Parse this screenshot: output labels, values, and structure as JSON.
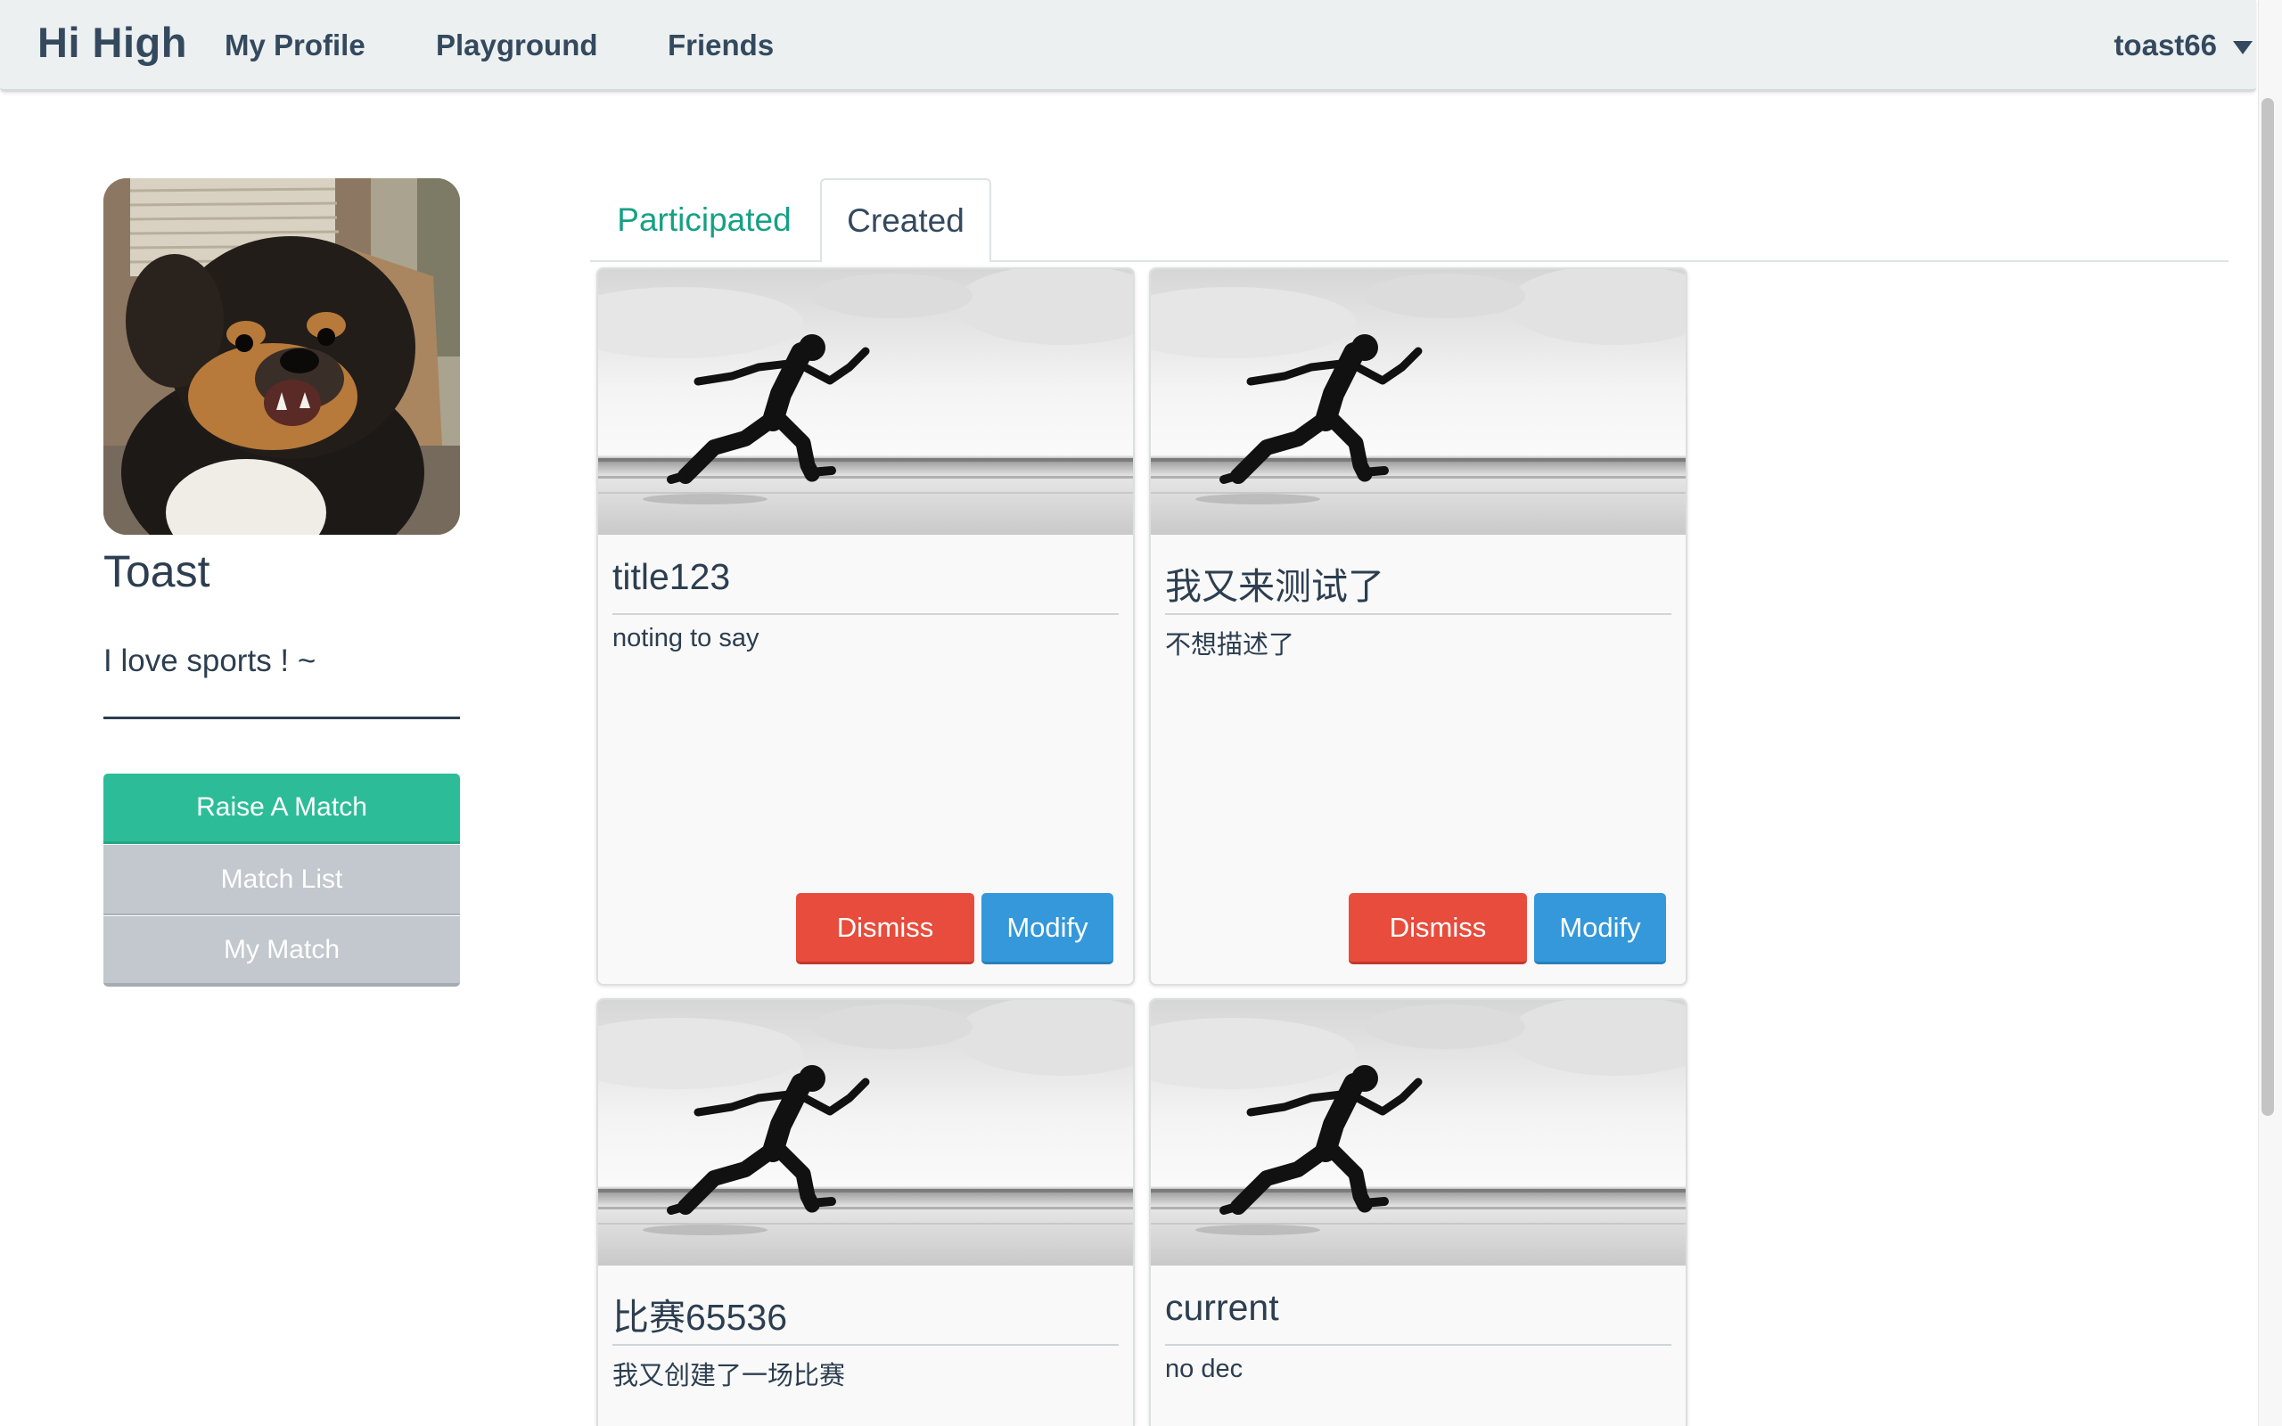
{
  "navbar": {
    "brand": "Hi High",
    "items": [
      {
        "label": "My Profile"
      },
      {
        "label": "Playground"
      },
      {
        "label": "Friends"
      }
    ],
    "username": "toast66"
  },
  "profile": {
    "name": "Toast",
    "bio": "I love sports ! ~",
    "actions": {
      "raise": "Raise A Match",
      "list": "Match List",
      "mine": "My Match"
    }
  },
  "tabs": {
    "participated": "Participated",
    "created": "Created"
  },
  "cards": [
    {
      "title": "title123",
      "description": "noting to say",
      "dismiss": "Dismiss",
      "modify": "Modify"
    },
    {
      "title": "我又来测试了",
      "description": "不想描述了",
      "dismiss": "Dismiss",
      "modify": "Modify"
    },
    {
      "title": "比赛65536",
      "description": "我又创建了一场比赛"
    },
    {
      "title": "current",
      "description": "no dec"
    }
  ],
  "colors": {
    "navbar_bg": "#ecf0f1",
    "primary": "#2cbd98",
    "tab_active_text": "#16a085",
    "danger": "#e74c3c",
    "info": "#3498db",
    "text": "#2c3e50"
  }
}
